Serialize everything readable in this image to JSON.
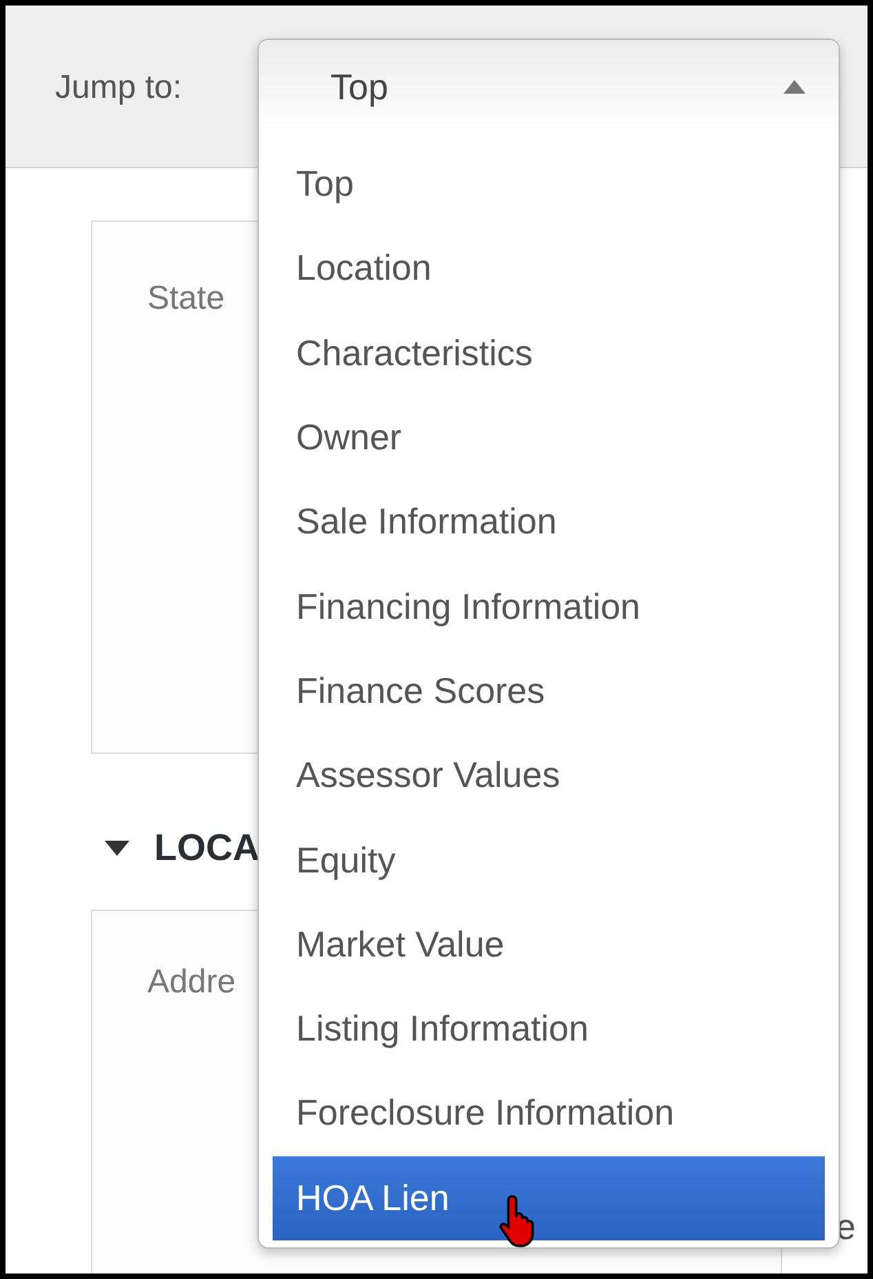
{
  "toolbar": {
    "label": "Jump to:",
    "select": {
      "value": "Top",
      "expanded": true
    }
  },
  "options": [
    {
      "label": "Top",
      "selected": false
    },
    {
      "label": "Location",
      "selected": false
    },
    {
      "label": "Characteristics",
      "selected": false
    },
    {
      "label": "Owner",
      "selected": false
    },
    {
      "label": "Sale Information",
      "selected": false
    },
    {
      "label": "Financing Information",
      "selected": false
    },
    {
      "label": "Finance Scores",
      "selected": false
    },
    {
      "label": "Assessor Values",
      "selected": false
    },
    {
      "label": "Equity",
      "selected": false
    },
    {
      "label": "Market Value",
      "selected": false
    },
    {
      "label": "Listing Information",
      "selected": false
    },
    {
      "label": "Foreclosure Information",
      "selected": false
    },
    {
      "label": "HOA Lien",
      "selected": true
    }
  ],
  "top_card": {
    "field_label": "State"
  },
  "location_section": {
    "title": "LOCA",
    "expanded": true,
    "field_label": "Addre",
    "field_value_tail": "e"
  }
}
